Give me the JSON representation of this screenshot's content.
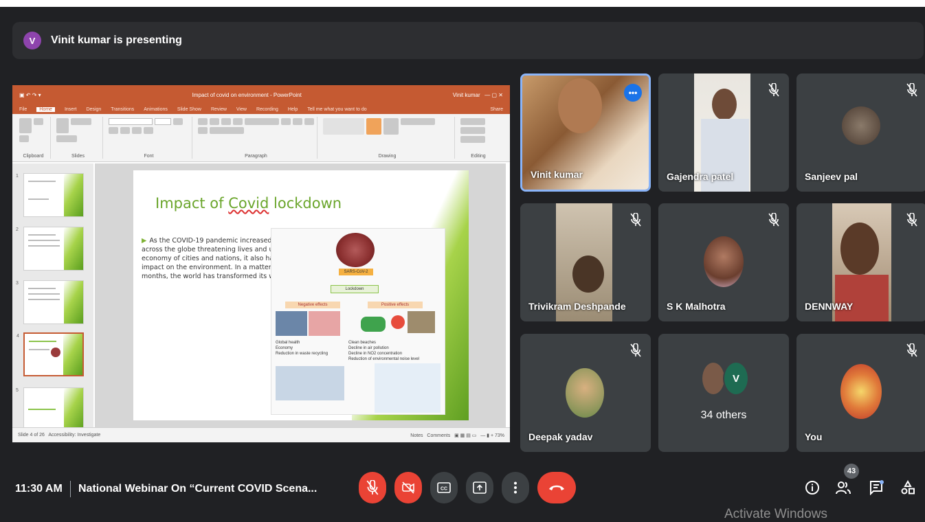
{
  "banner": {
    "avatar_letter": "V",
    "text": "Vinit kumar is presenting"
  },
  "presentation": {
    "window_title": "Impact of covid on environment - PowerPoint",
    "user": "Vinit kumar",
    "tabs": [
      "File",
      "Home",
      "Insert",
      "Design",
      "Transitions",
      "Animations",
      "Slide Show",
      "Review",
      "View",
      "Recording",
      "Help",
      "Tell me what you want to do"
    ],
    "share": "Share",
    "ribbon_groups": [
      "Clipboard",
      "Slides",
      "Font",
      "Paragraph",
      "Drawing",
      "Editing"
    ],
    "thumbnail_numbers": [
      "1",
      "2",
      "3",
      "4",
      "5"
    ],
    "slide_title_prefix": "Impact of ",
    "slide_title_underlined": "Covid",
    "slide_title_suffix": " lockdown",
    "slide_body": "As the COVID-19 pandemic increased exponentially across the globe threatening lives and uprooting the economy of cities and nations, it also had a major impact on the environment. In a matter of a few months, the world has transformed its way of living.",
    "figure": {
      "virus_label": "SARS-CoV-2",
      "lockdown": "Lockdown",
      "negative": "Negative effects",
      "positive": "Positive effects",
      "neg_items": [
        "Global health",
        "Economy",
        "Reduction in waste recycling"
      ],
      "pos_items": [
        "Clean beaches",
        "Decline in air pollution",
        "Decline in NO2 concentration",
        "Reduction of environmental noise level"
      ]
    },
    "status_left": "Slide 4 of 26",
    "status_access": "Accessibility: Investigate",
    "status_notes": "Notes",
    "status_comments": "Comments",
    "status_zoom": "73%"
  },
  "participants": [
    {
      "name": "Vinit kumar",
      "muted": false,
      "active": true
    },
    {
      "name": "Gajendra patel",
      "muted": true
    },
    {
      "name": "Sanjeev pal",
      "muted": true
    },
    {
      "name": "Trivikram Deshpande",
      "muted": true
    },
    {
      "name": "S K Malhotra",
      "muted": true
    },
    {
      "name": "DENNWAY",
      "muted": true
    },
    {
      "name": "Deepak yadav",
      "muted": true
    },
    {
      "name": "34 others",
      "avatar_letter": "V",
      "muted": false
    },
    {
      "name": "You",
      "muted": true
    }
  ],
  "bottom": {
    "time": "11:30 AM",
    "meeting_title": "National Webinar On “Current COVID Scena...",
    "participant_count": "43",
    "watermark": "Activate Windows"
  },
  "colors": {
    "accent": "#1a73e8",
    "danger": "#ea4335",
    "ppt": "#c55a32"
  }
}
